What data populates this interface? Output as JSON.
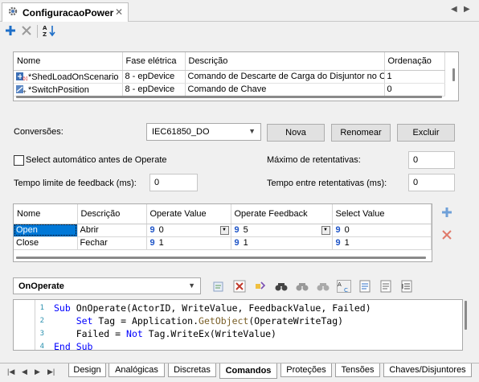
{
  "document": {
    "tab_title": "ConfiguracaoPower"
  },
  "scenarios": {
    "columns": [
      "Nome",
      "Fase elétrica",
      "Descrição",
      "Ordenação"
    ],
    "rows": [
      [
        "*ShedLoadOnScenario",
        "8 - epDevice",
        "Comando de Descarte de Carga do Disjuntor no Ce",
        "1"
      ],
      [
        "*SwitchPosition",
        "8 - epDevice",
        "Comando de Chave",
        "0"
      ]
    ]
  },
  "form": {
    "conversoes_label": "Conversões:",
    "conversoes_value": "IEC61850_DO",
    "nova": "Nova",
    "renomear": "Renomear",
    "excluir": "Excluir",
    "select_auto_label": "Select automático antes de Operate",
    "max_retentativas_label": "Máximo de retentativas:",
    "max_retentativas_value": "0",
    "tempo_limite_label": "Tempo limite de feedback (ms):",
    "tempo_limite_value": "0",
    "tempo_entre_label": "Tempo entre retentativas (ms):",
    "tempo_entre_value": "0"
  },
  "commands": {
    "columns": [
      "Nome",
      "Descrição",
      "Operate Value",
      "Operate Feedback",
      "Select Value"
    ],
    "rows": [
      {
        "nome": "Open",
        "descricao": "Abrir",
        "operate_value": "0",
        "operate_feedback": "5",
        "select_value": "0"
      },
      {
        "nome": "Close",
        "descricao": "Fechar",
        "operate_value": "1",
        "operate_feedback": "1",
        "select_value": "1"
      }
    ]
  },
  "script": {
    "event": "OnOperate",
    "line_numbers": [
      "1",
      "2",
      "3",
      "4"
    ],
    "lines": [
      [
        [
          "kw",
          "Sub"
        ],
        [
          "t",
          " OnOperate(ActorID, WriteValue, FeedbackValue, Failed)"
        ]
      ],
      [
        [
          "t",
          "    "
        ],
        [
          "kw",
          "Set"
        ],
        [
          "t",
          " Tag = Application."
        ],
        [
          "fn",
          "GetObject"
        ],
        [
          "t",
          "(OperateWriteTag)"
        ]
      ],
      [
        [
          "t",
          "    Failed = "
        ],
        [
          "kw",
          "Not"
        ],
        [
          "t",
          " Tag.WriteEx(WriteValue)"
        ]
      ],
      [
        [
          "kw",
          "End Sub"
        ]
      ]
    ]
  },
  "bottom_tabs": [
    "Design",
    "Analógicas",
    "Discretas",
    "Comandos",
    "Proteções",
    "Tensões",
    "Chaves/Disjuntores"
  ],
  "active_bottom_tab": "Comandos",
  "icons": [
    "gear-icon",
    "close-icon",
    "left-arrow-icon",
    "right-arrow-icon",
    "add-icon",
    "delete-icon",
    "sort-az-icon",
    "dropdown-arrow-icon",
    "find-icon",
    "find-next-icon",
    "replace-icon",
    "comment-icon",
    "indent-icon"
  ],
  "colors": {
    "selection": "#0078d7",
    "add_blue": "#1e6fc8",
    "delete_red": "#c0392b",
    "code_keyword": "#0000ff",
    "line_number": "#2b91af"
  }
}
